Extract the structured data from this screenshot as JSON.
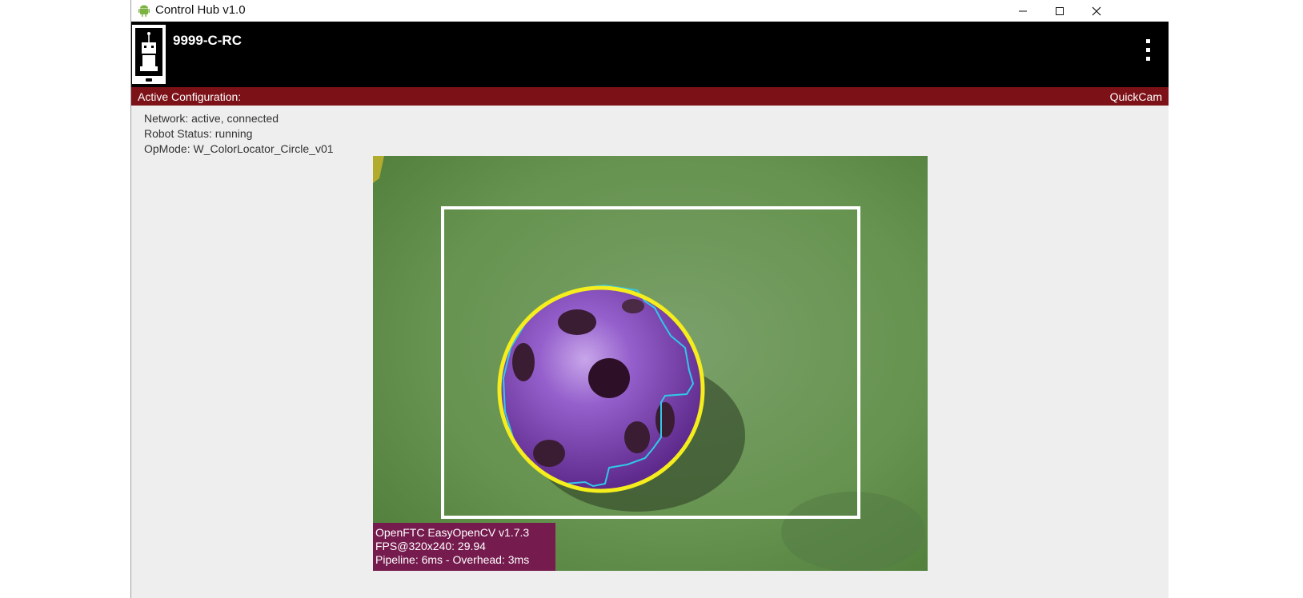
{
  "window": {
    "title": "Control Hub v1.0",
    "title_icon": "android-icon",
    "controls": [
      "minimize-icon",
      "maximize-icon",
      "close-icon"
    ]
  },
  "header": {
    "robot_name": "9999-C-RC",
    "app_icon": "robot-phone-icon",
    "menu_icon": "kebab-menu-icon"
  },
  "config": {
    "label": "Active Configuration:",
    "value": "QuickCam",
    "bar_color": "#7c1117"
  },
  "status": {
    "network": "Network: active, connected",
    "robot": "Robot Status: running",
    "opmode": "OpMode: W_ColorLocator_Circle_v01"
  },
  "camera": {
    "overlay_line1": "OpenFTC EasyOpenCV v1.7.3",
    "overlay_line2": "FPS@320x240: 29.94",
    "overlay_line3": "Pipeline: 6ms - Overhead: 3ms",
    "roi_color": "#ffffff",
    "circle_color": "#f5ee1c",
    "contour_color": "#30c8e8",
    "ball_color": "#8a4fc0"
  }
}
